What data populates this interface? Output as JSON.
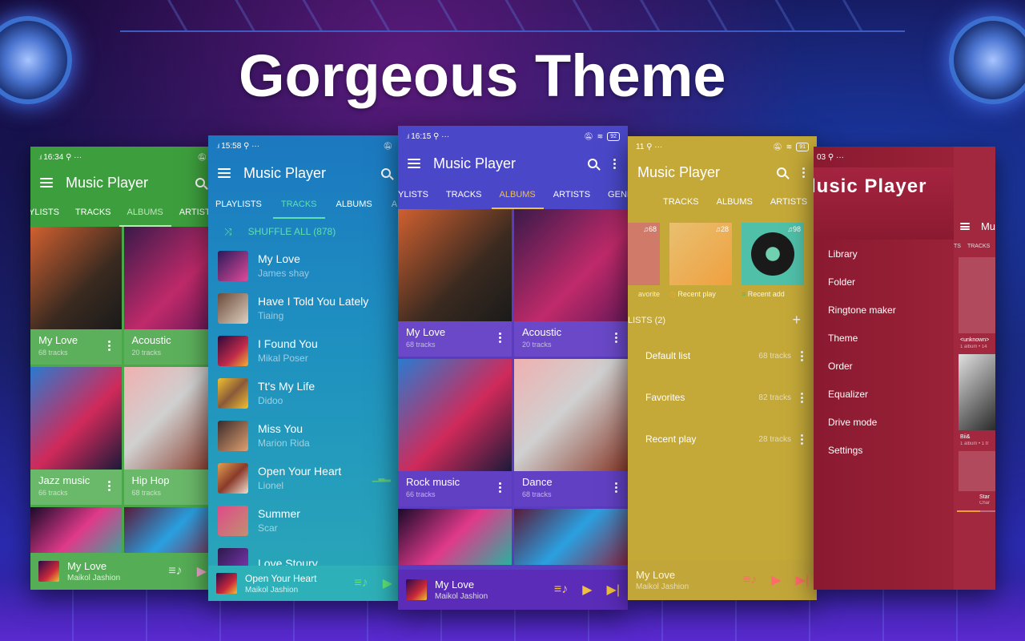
{
  "headline": "Gorgeous Theme",
  "app_name": "Music Player",
  "phones": {
    "green": {
      "status_time": "16:34",
      "tabs": [
        "YLISTS",
        "TRACKS",
        "ALBUMS",
        "ARTISTS"
      ],
      "active_tab": "ALBUMS",
      "accent": "#a6d8a6",
      "albums": [
        {
          "title": "My Love",
          "count": "68 tracks"
        },
        {
          "title": "Acoustic",
          "count": "20 tracks"
        },
        {
          "title": "Jazz music",
          "count": "66 tracks"
        },
        {
          "title": "Hip Hop",
          "count": "68 tracks"
        }
      ],
      "now_playing": {
        "title": "My Love",
        "artist": "Maikol Jashion"
      }
    },
    "blue": {
      "status_time": "15:58",
      "tabs": [
        "PLAYLISTS",
        "TRACKS",
        "ALBUMS",
        "ARTIS"
      ],
      "active_tab": "TRACKS",
      "accent": "#5ee0b0",
      "shuffle_label": "SHUFFLE ALL (878)",
      "tracks": [
        {
          "title": "My Love",
          "artist": "James shay"
        },
        {
          "title": "Have I Told You Lately",
          "artist": "Tiaing"
        },
        {
          "title": "I Found You",
          "artist": "Mikal Poser"
        },
        {
          "title": "Tt's My Life",
          "artist": "Didoo"
        },
        {
          "title": "Miss You",
          "artist": "Marion Rida"
        },
        {
          "title": "Open Your Heart",
          "artist": "Lionel"
        },
        {
          "title": "Summer",
          "artist": "Scar"
        },
        {
          "title": "Love Stoury",
          "artist": ""
        }
      ],
      "now_playing": {
        "title": "Open Your Heart",
        "artist": "Maikol Jashion"
      }
    },
    "purple": {
      "status_time": "16:15",
      "battery": "92",
      "tabs": [
        "YLISTS",
        "TRACKS",
        "ALBUMS",
        "ARTISTS",
        "GENRE"
      ],
      "active_tab": "ALBUMS",
      "accent": "#f0c040",
      "albums": [
        {
          "title": "My Love",
          "count": "68 tracks"
        },
        {
          "title": "Acoustic",
          "count": "20 tracks"
        },
        {
          "title": "Rock music",
          "count": "66 tracks"
        },
        {
          "title": "Dance",
          "count": "68 tracks"
        }
      ],
      "now_playing": {
        "title": "My Love",
        "artist": "Maikol Jashion"
      }
    },
    "yellow": {
      "status_time": "11",
      "battery": "91",
      "tabs": [
        "TRACKS",
        "ALBUMS",
        "ARTISTS"
      ],
      "accent": "#ff6a6a",
      "cards": [
        {
          "label": "avorite",
          "count": "68"
        },
        {
          "label": "Recent play",
          "count": "28"
        },
        {
          "label": "Recent add",
          "count": "98"
        }
      ],
      "playlists_header": "LISTS  (2)",
      "playlists": [
        {
          "name": "Default list",
          "count": "68 tracks"
        },
        {
          "name": "Favorites",
          "count": "82 tracks"
        },
        {
          "name": "Recent play",
          "count": "28 tracks"
        }
      ],
      "now_playing": {
        "title": "My Love",
        "artist": "Maikol Jashion"
      }
    },
    "red": {
      "status_time": "03",
      "drawer_title": "lusic  Player",
      "drawer_items": [
        "Library",
        "Folder",
        "Ringtone maker",
        "Theme",
        "Order",
        "Equalizer",
        "Drive mode",
        "Settings"
      ],
      "behind_title": "Mu",
      "behind_tabs": [
        "TS",
        "TRACKS"
      ],
      "behind_artists": [
        {
          "name": "<unknown>",
          "meta": "1 album • 14"
        },
        {
          "name": "Bii&",
          "meta": "1 album • 1 tr"
        }
      ],
      "now_playing": {
        "title": "Star",
        "artist": "Char"
      }
    }
  }
}
